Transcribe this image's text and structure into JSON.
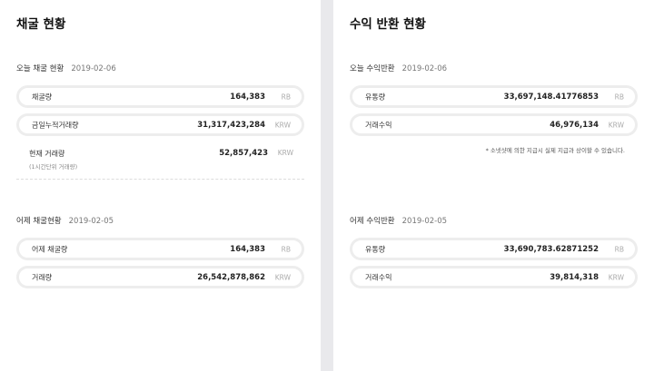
{
  "mining": {
    "title": "채굴 현황",
    "today": {
      "label": "오늘 채굴 현황",
      "date": "2019-02-06",
      "rows": [
        {
          "label": "채굴량",
          "value": "164,383",
          "unit": "RB"
        },
        {
          "label": "금일누적거래량",
          "value": "31,317,423,284",
          "unit": "KRW"
        }
      ],
      "current": {
        "label": "현재 거래량",
        "sub": "(1시간단위 거래량)",
        "value": "52,857,423",
        "unit": "KRW"
      }
    },
    "yesterday": {
      "label": "어제 채굴현황",
      "date": "2019-02-05",
      "rows": [
        {
          "label": "어제 채굴량",
          "value": "164,383",
          "unit": "RB"
        },
        {
          "label": "거래량",
          "value": "26,542,878,862",
          "unit": "KRW"
        }
      ]
    }
  },
  "revenue": {
    "title": "수익 반환 현황",
    "today": {
      "label": "오늘 수익반환",
      "date": "2019-02-06",
      "rows": [
        {
          "label": "유통량",
          "value": "33,697,148.41776853",
          "unit": "RB"
        },
        {
          "label": "거래수익",
          "value": "46,976,134",
          "unit": "KRW"
        }
      ],
      "note": "* 소넷샷에 의한 지급시 실제 지급과 상이할 수 있습니다."
    },
    "yesterday": {
      "label": "어제 수익반환",
      "date": "2019-02-05",
      "rows": [
        {
          "label": "유통량",
          "value": "33,690,783.62871252",
          "unit": "RB"
        },
        {
          "label": "거래수익",
          "value": "39,814,318",
          "unit": "KRW"
        }
      ]
    }
  }
}
